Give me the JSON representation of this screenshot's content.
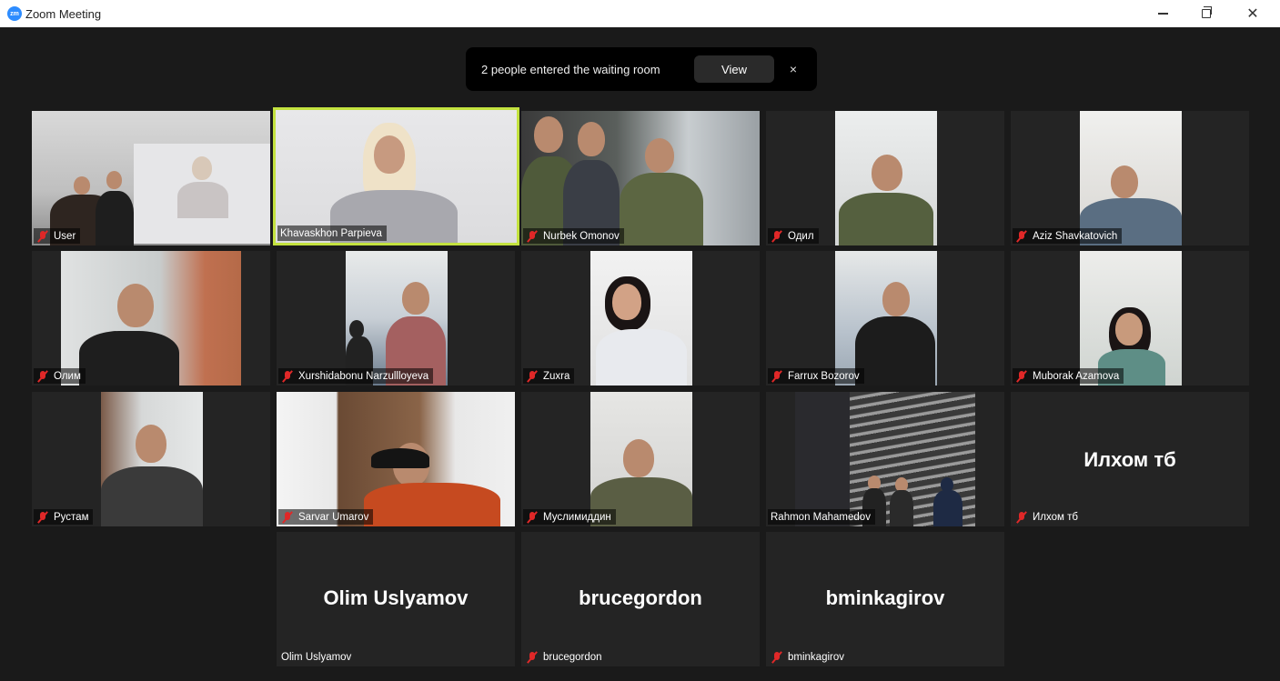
{
  "window": {
    "app_icon": "zm",
    "title": "Zoom Meeting"
  },
  "notification": {
    "text": "2 people entered the waiting room",
    "view_label": "View",
    "close_glyph": "×"
  },
  "participants": [
    {
      "name": "User",
      "muted": true
    },
    {
      "name": "Khavaskhon Parpieva",
      "muted": false,
      "active_speaker": true
    },
    {
      "name": "Nurbek Omonov",
      "muted": true
    },
    {
      "name": "Одил",
      "muted": true
    },
    {
      "name": "Aziz Shavkatovich",
      "muted": true
    },
    {
      "name": "Олим",
      "muted": true
    },
    {
      "name": "Xurshidabonu Narzullloyeva",
      "muted": true
    },
    {
      "name": "Zuxra",
      "muted": true
    },
    {
      "name": "Farrux Bozorov",
      "muted": true
    },
    {
      "name": "Muborak Azamova",
      "muted": true
    },
    {
      "name": "Рустам",
      "muted": true
    },
    {
      "name": "Sarvar Umarov",
      "muted": true
    },
    {
      "name": "Муслимиддин",
      "muted": true
    },
    {
      "name": "Rahmon Mahamedov",
      "muted": false
    },
    {
      "name": "Илхом тб",
      "muted": true,
      "video_off": true,
      "display_name": "Илхом тб"
    },
    {
      "name": "Olim Uslyamov",
      "muted": false,
      "video_off": true,
      "display_name": "Olim Uslyamov"
    },
    {
      "name": "brucegordon",
      "muted": true,
      "video_off": true,
      "display_name": "brucegordon"
    },
    {
      "name": "bminkagirov",
      "muted": true,
      "video_off": true,
      "display_name": "bminkagirov"
    }
  ],
  "colors": {
    "active_speaker_border": "#c3e23f",
    "muted_icon": "#e02828",
    "tile_bg": "#242424",
    "stage_bg": "#1a1a1a"
  }
}
